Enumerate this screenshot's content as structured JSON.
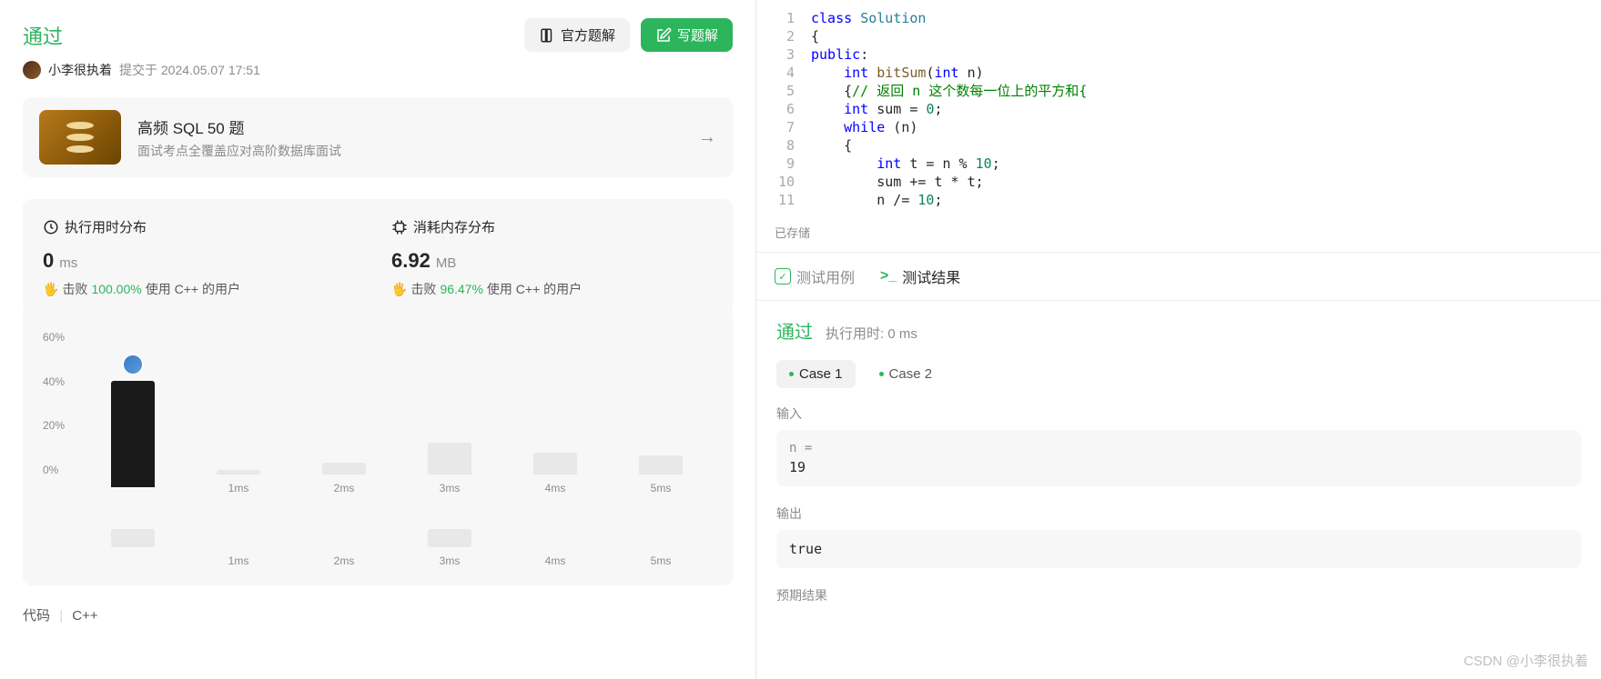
{
  "left": {
    "status": "通过",
    "username": "小李很执着",
    "submit_info": "提交于 2024.05.07 17:51",
    "btn_official": "官方题解",
    "btn_write": "写题解",
    "promo": {
      "title": "高频 SQL 50 题",
      "subtitle": "面试考点全覆盖应对高阶数据库面试"
    },
    "runtime": {
      "header": "执行用时分布",
      "value": "0",
      "unit": "ms",
      "beat_label": "击败",
      "beat_pct": "100.00%",
      "beat_suffix": "使用 C++ 的用户"
    },
    "memory": {
      "header": "消耗内存分布",
      "value": "6.92",
      "unit": "MB",
      "beat_label": "击败",
      "beat_pct": "96.47%",
      "beat_suffix": "使用 C++ 的用户"
    },
    "code_label": "代码",
    "code_lang": "C++"
  },
  "chart_data": {
    "type": "bar",
    "title": "执行用时分布",
    "xlabel": "",
    "ylabel": "",
    "ylim": [
      0,
      60
    ],
    "y_ticks": [
      "60%",
      "40%",
      "20%",
      "0%"
    ],
    "categories": [
      "",
      "1ms",
      "2ms",
      "3ms",
      "4ms",
      "5ms"
    ],
    "values": [
      44,
      2,
      5,
      13,
      9,
      8
    ],
    "highlight_index": 0,
    "mini_categories": [
      "",
      "1ms",
      "2ms",
      "3ms",
      "4ms",
      "5ms"
    ],
    "mini_filled": [
      true,
      false,
      false,
      true,
      false,
      false
    ]
  },
  "code": {
    "lines": [
      {
        "n": "1",
        "html": "<span class='kw'>class</span> <span class='type'>Solution</span>"
      },
      {
        "n": "2",
        "html": "{"
      },
      {
        "n": "3",
        "html": "<span class='kw'>public</span>:"
      },
      {
        "n": "4",
        "html": "    <span class='kw'>int</span> <span class='fn'>bitSum</span>(<span class='kw'>int</span> n)"
      },
      {
        "n": "5",
        "html": "    {<span class='cmt'>// 返回 n 这个数每一位上的平方和{</span>"
      },
      {
        "n": "6",
        "html": "    <span class='kw'>int</span> sum = <span class='num'>0</span>;"
      },
      {
        "n": "7",
        "html": "    <span class='kw'>while</span> (n)"
      },
      {
        "n": "8",
        "html": "    {"
      },
      {
        "n": "9",
        "html": "        <span class='kw'>int</span> t = n % <span class='num'>10</span>;"
      },
      {
        "n": "10",
        "html": "        sum += t * t;"
      },
      {
        "n": "11",
        "html": "        n /= <span class='num'>10</span>;"
      }
    ]
  },
  "saved": "已存储",
  "test": {
    "tab_cases": "测试用例",
    "tab_results": "测试结果",
    "pass": "通过",
    "runtime": "执行用时: 0 ms",
    "case1": "Case 1",
    "case2": "Case 2",
    "input_label": "输入",
    "input_var": "n =",
    "input_val": "19",
    "output_label": "输出",
    "output_val": "true",
    "expected_label": "预期结果"
  },
  "watermark": "CSDN @小李很执着"
}
